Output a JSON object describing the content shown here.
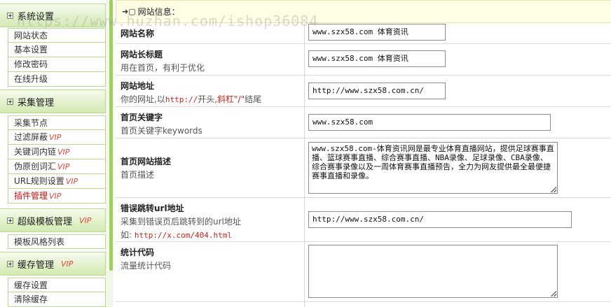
{
  "sidebar": {
    "groups": [
      {
        "title": "系统设置",
        "vip": "",
        "items": [
          {
            "label": "网站状态",
            "vip": ""
          },
          {
            "label": "基本设置",
            "vip": ""
          },
          {
            "label": "修改密码",
            "vip": ""
          },
          {
            "label": "在线升级",
            "vip": ""
          }
        ]
      },
      {
        "title": "采集管理",
        "vip": "",
        "items": [
          {
            "label": "采集节点",
            "vip": ""
          },
          {
            "label": "过滤屏蔽",
            "vip": "VIP"
          },
          {
            "label": "关键词内链",
            "vip": "VIP"
          },
          {
            "label": "伪原创词汇",
            "vip": "VIP"
          },
          {
            "label": "URL规则设置",
            "vip": "VIP"
          },
          {
            "label": "插件管理",
            "vip": "VIP"
          }
        ]
      },
      {
        "title": "超级模板管理",
        "vip": "VIP",
        "items": [
          {
            "label": "模板风格列表",
            "vip": ""
          }
        ]
      },
      {
        "title": "缓存管理",
        "vip": "VIP",
        "items": [
          {
            "label": "缓存设置",
            "vip": ""
          },
          {
            "label": "清除缓存",
            "vip": ""
          }
        ]
      }
    ]
  },
  "main": {
    "section_title": "网站信息：",
    "watermark": "https://www.huzhan.com/ishop36084",
    "fields": {
      "site_name": {
        "title": "网站名称",
        "value": "www.szx58.com 体育资讯"
      },
      "site_long_title": {
        "title": "网站长标题",
        "desc": "用在首页，有利于优化",
        "value": "www.szx58.com 体育资讯"
      },
      "site_url": {
        "title": "网站地址",
        "desc_prefix": "你的网址,以",
        "desc_red1": "http://",
        "desc_mid": "开头,",
        "desc_red2": "斜杠\"/\"",
        "desc_suffix": "结尾",
        "value": "http://www.szx58.com.cn/"
      },
      "keywords": {
        "title": "首页关键字",
        "desc": "首页关键字keywords",
        "value": "www.szx58.com"
      },
      "description": {
        "title": "首页网站描述",
        "desc": "首页描述",
        "value": "www.szx58.com-体育资讯网是最专业体育直播网站，提供足球赛事直播、篮球赛事直播、综合赛事直播、NBA录像、足球录像、CBA录像、综合赛事录像以及一周体育赛事直播预告，全力为网友提供最全最便捷赛事直播和录像。"
      },
      "error_url": {
        "title": "错误跳转url地址",
        "desc": "采集到错误页后跳转到的url地址",
        "example_prefix": "如:",
        "example_url": "http://x.com/404.html",
        "value": "http://www.szx58.com.cn/"
      },
      "stats_code": {
        "title": "统计代码",
        "desc": "流量统计代码",
        "value": ""
      }
    }
  }
}
